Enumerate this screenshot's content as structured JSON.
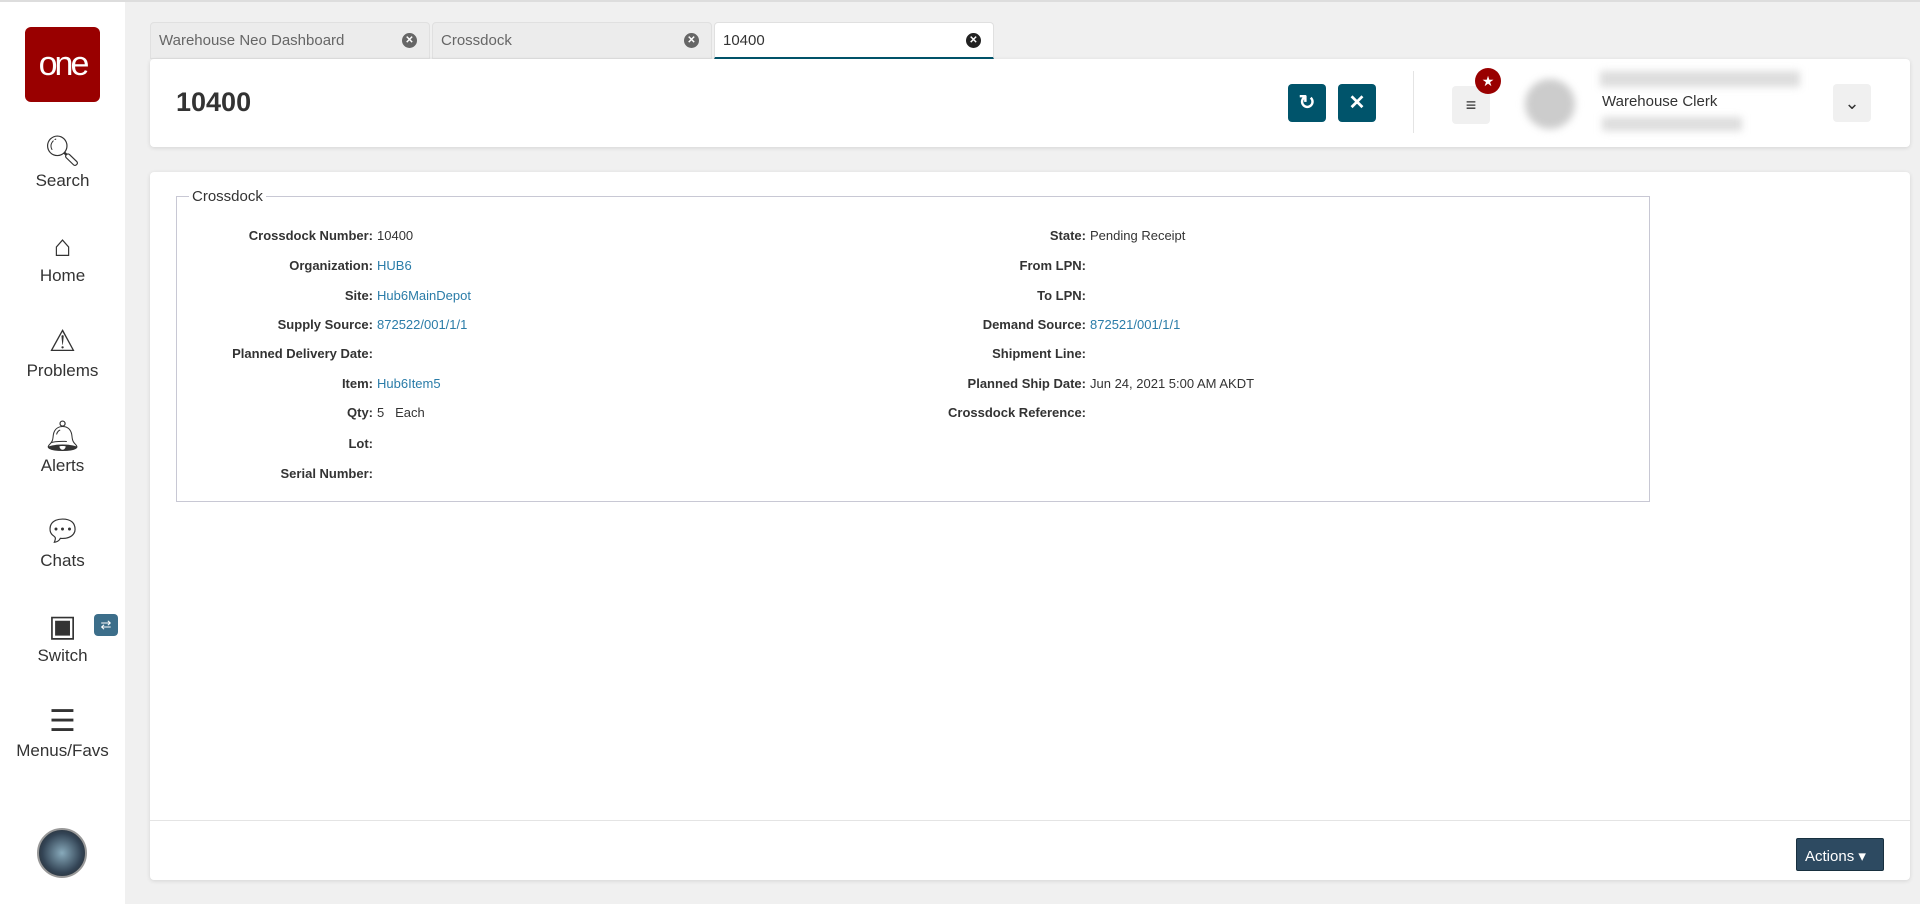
{
  "sidebar": {
    "logo": "one",
    "items": [
      {
        "label": "Search",
        "icon": "search-icon"
      },
      {
        "label": "Home",
        "icon": "home-icon"
      },
      {
        "label": "Problems",
        "icon": "warning-icon"
      },
      {
        "label": "Alerts",
        "icon": "bell-icon"
      },
      {
        "label": "Chats",
        "icon": "chat-icon"
      },
      {
        "label": "Switch",
        "icon": "switch-icon"
      },
      {
        "label": "Menus/Favs",
        "icon": "menu-icon"
      }
    ]
  },
  "tabs": [
    {
      "label": "Warehouse Neo Dashboard"
    },
    {
      "label": "Crossdock"
    },
    {
      "label": "10400",
      "active": true
    }
  ],
  "header": {
    "title": "10400",
    "user_role": "Warehouse Clerk"
  },
  "section": {
    "legend": "Crossdock",
    "left": [
      {
        "label": "Crossdock Number:",
        "value": "10400"
      },
      {
        "label": "Organization:",
        "value": "HUB6",
        "link": true
      },
      {
        "label": "Site:",
        "value": "Hub6MainDepot",
        "link": true
      },
      {
        "label": "Supply Source:",
        "value": "872522/001/1/1",
        "link": true
      },
      {
        "label": "Planned Delivery Date:",
        "value": ""
      },
      {
        "label": "Item:",
        "value": "Hub6Item5",
        "link": true
      },
      {
        "label": "Qty:",
        "value": "5   Each"
      },
      {
        "label": "Lot:",
        "value": ""
      },
      {
        "label": "Serial Number:",
        "value": ""
      }
    ],
    "right": [
      {
        "label": "State:",
        "value": "Pending Receipt"
      },
      {
        "label": "From LPN:",
        "value": ""
      },
      {
        "label": "To LPN:",
        "value": ""
      },
      {
        "label": "Demand Source:",
        "value": "872521/001/1/1",
        "link": true
      },
      {
        "label": "Shipment Line:",
        "value": ""
      },
      {
        "label": "Planned Ship Date:",
        "value": "Jun 24, 2021 5:00 AM AKDT"
      },
      {
        "label": "Crossdock Reference:",
        "value": ""
      }
    ]
  },
  "footer": {
    "actions_label": "Actions"
  },
  "colors": {
    "brand": "#990000",
    "accent": "#00546b",
    "link": "#2a7ca8"
  }
}
